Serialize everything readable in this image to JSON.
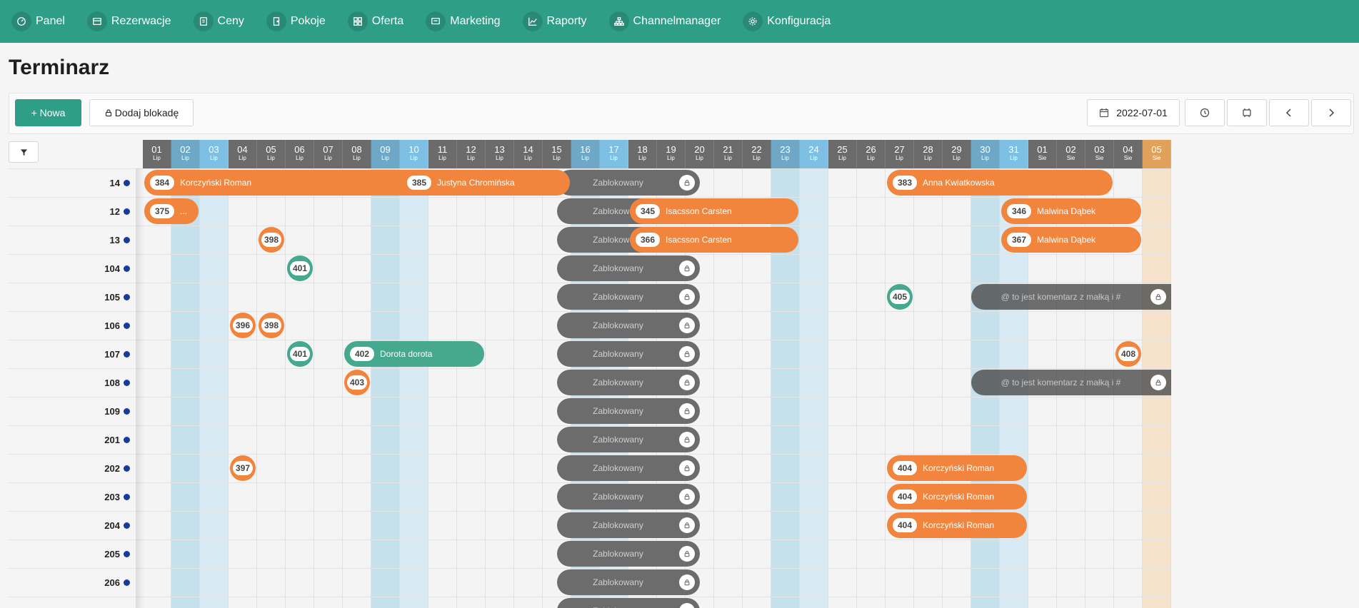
{
  "nav": [
    {
      "label": "Panel",
      "icon": "dashboard-icon"
    },
    {
      "label": "Rezerwacje",
      "icon": "reservations-icon"
    },
    {
      "label": "Ceny",
      "icon": "prices-icon"
    },
    {
      "label": "Pokoje",
      "icon": "door-icon"
    },
    {
      "label": "Oferta",
      "icon": "offer-icon"
    },
    {
      "label": "Marketing",
      "icon": "marketing-icon"
    },
    {
      "label": "Raporty",
      "icon": "chart-icon"
    },
    {
      "label": "Channelmanager",
      "icon": "sitemap-icon"
    },
    {
      "label": "Konfiguracja",
      "icon": "gear-icon"
    }
  ],
  "page_title": "Terminarz",
  "toolbar": {
    "new_label": "+ Nowa",
    "block_label": "Dodaj blokadę",
    "date": "2022-07-01"
  },
  "colors": {
    "primary": "#2e9e86",
    "orange": "#f2853e",
    "green": "#46a98f",
    "blocked": "#6c6c6c",
    "weekend_sat": "#c6e0ec",
    "weekend_sun": "#d8ebf5",
    "today": "#f7e3cb"
  },
  "days": [
    {
      "d": "01",
      "m": "Lip",
      "t": "n"
    },
    {
      "d": "02",
      "m": "Lip",
      "t": "sat"
    },
    {
      "d": "03",
      "m": "Lip",
      "t": "sun"
    },
    {
      "d": "04",
      "m": "Lip",
      "t": "n"
    },
    {
      "d": "05",
      "m": "Lip",
      "t": "n"
    },
    {
      "d": "06",
      "m": "Lip",
      "t": "n"
    },
    {
      "d": "07",
      "m": "Lip",
      "t": "n"
    },
    {
      "d": "08",
      "m": "Lip",
      "t": "n"
    },
    {
      "d": "09",
      "m": "Lip",
      "t": "sat"
    },
    {
      "d": "10",
      "m": "Lip",
      "t": "sun"
    },
    {
      "d": "11",
      "m": "Lip",
      "t": "n"
    },
    {
      "d": "12",
      "m": "Lip",
      "t": "n"
    },
    {
      "d": "13",
      "m": "Lip",
      "t": "n"
    },
    {
      "d": "14",
      "m": "Lip",
      "t": "n"
    },
    {
      "d": "15",
      "m": "Lip",
      "t": "n"
    },
    {
      "d": "16",
      "m": "Lip",
      "t": "sat"
    },
    {
      "d": "17",
      "m": "Lip",
      "t": "sun"
    },
    {
      "d": "18",
      "m": "Lip",
      "t": "n"
    },
    {
      "d": "19",
      "m": "Lip",
      "t": "n"
    },
    {
      "d": "20",
      "m": "Lip",
      "t": "n"
    },
    {
      "d": "21",
      "m": "Lip",
      "t": "n"
    },
    {
      "d": "22",
      "m": "Lip",
      "t": "n"
    },
    {
      "d": "23",
      "m": "Lip",
      "t": "sat"
    },
    {
      "d": "24",
      "m": "Lip",
      "t": "sun"
    },
    {
      "d": "25",
      "m": "Lip",
      "t": "n"
    },
    {
      "d": "26",
      "m": "Lip",
      "t": "n"
    },
    {
      "d": "27",
      "m": "Lip",
      "t": "n"
    },
    {
      "d": "28",
      "m": "Lip",
      "t": "n"
    },
    {
      "d": "29",
      "m": "Lip",
      "t": "n"
    },
    {
      "d": "30",
      "m": "Lip",
      "t": "sat"
    },
    {
      "d": "31",
      "m": "Lip",
      "t": "sun"
    },
    {
      "d": "01",
      "m": "Sie",
      "t": "n"
    },
    {
      "d": "02",
      "m": "Sie",
      "t": "n"
    },
    {
      "d": "03",
      "m": "Sie",
      "t": "n"
    },
    {
      "d": "04",
      "m": "Sie",
      "t": "n"
    },
    {
      "d": "05",
      "m": "Sie",
      "t": "today"
    }
  ],
  "rooms": [
    "14",
    "12",
    "13",
    "104",
    "105",
    "106",
    "107",
    "108",
    "109",
    "201",
    "202",
    "203",
    "204",
    "205",
    "206",
    ""
  ],
  "blocked_label": "Zablokowany",
  "reservations": [
    {
      "row": 0,
      "from": "01",
      "to": "10",
      "num": "384",
      "name": "Korczyński Roman",
      "color": "orange"
    },
    {
      "row": 0,
      "from": "10",
      "to": "15",
      "num": "385",
      "name": "Justyna Chromińska",
      "color": "orange"
    },
    {
      "row": 0,
      "from": "27",
      "to": "03",
      "num": "383",
      "name": "Anna Kwiatkowska",
      "color": "orange"
    },
    {
      "row": 1,
      "from": "01",
      "to": "02",
      "num": "375",
      "name": "...",
      "color": "orange"
    },
    {
      "row": 1,
      "from": "18",
      "to": "23",
      "num": "345",
      "name": "Isacsson Carsten",
      "color": "orange"
    },
    {
      "row": 1,
      "from": "31",
      "to": "04",
      "num": "346",
      "name": "Malwina Dąbek",
      "color": "orange"
    },
    {
      "row": 2,
      "from": "18",
      "to": "23",
      "num": "366",
      "name": "Isacsson Carsten",
      "color": "orange"
    },
    {
      "row": 2,
      "from": "31",
      "to": "04",
      "num": "367",
      "name": "Malwina Dąbek",
      "color": "orange"
    },
    {
      "row": 6,
      "from": "08",
      "to": "12",
      "num": "402",
      "name": "Dorota dorota",
      "color": "green"
    },
    {
      "row": 10,
      "from": "27",
      "to": "31",
      "num": "404",
      "name": "Korczyński Roman",
      "color": "orange"
    },
    {
      "row": 11,
      "from": "27",
      "to": "31",
      "num": "404",
      "name": "Korczyński Roman",
      "color": "orange"
    },
    {
      "row": 12,
      "from": "27",
      "to": "31",
      "num": "404",
      "name": "Korczyński Roman",
      "color": "orange"
    }
  ],
  "dots": [
    {
      "row": 2,
      "day": "05",
      "num": "398",
      "color": "orange"
    },
    {
      "row": 3,
      "day": "06",
      "num": "401",
      "color": "green"
    },
    {
      "row": 4,
      "day": "27",
      "num": "405",
      "color": "green"
    },
    {
      "row": 5,
      "day": "04",
      "num": "396",
      "color": "orange"
    },
    {
      "row": 5,
      "day": "05",
      "num": "398",
      "color": "orange"
    },
    {
      "row": 6,
      "day": "06",
      "num": "401",
      "color": "green"
    },
    {
      "row": 6,
      "day": "34",
      "num": "408",
      "color": "orange"
    },
    {
      "row": 7,
      "day": "08",
      "num": "403",
      "color": "orange"
    },
    {
      "row": 10,
      "day": "04",
      "num": "397",
      "color": "orange"
    }
  ],
  "comments": [
    {
      "row": 4,
      "text": "@ to jest komentarz z małką i #"
    },
    {
      "row": 7,
      "text": "@ to jest komentarz z małką i #"
    }
  ]
}
